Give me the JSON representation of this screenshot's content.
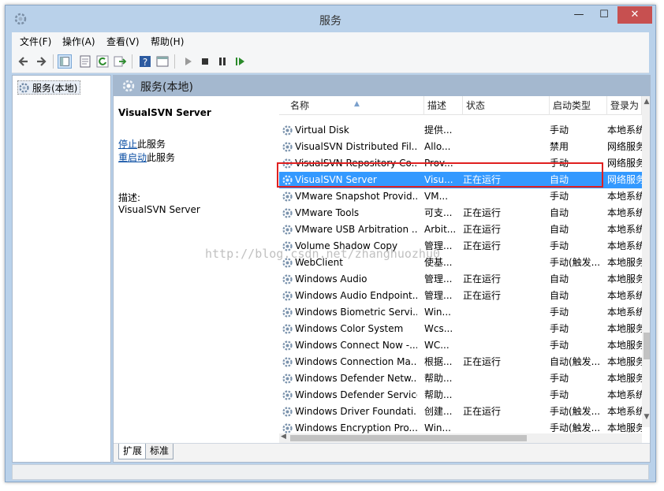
{
  "window": {
    "title": "服务",
    "close_label": "✕",
    "min_label": "—",
    "max_label": "☐"
  },
  "menu": [
    "文件(F)",
    "操作(A)",
    "查看(V)",
    "帮助(H)"
  ],
  "toolbar_icons": [
    "back-icon",
    "forward-icon",
    "show-tree-icon",
    "properties-icon",
    "refresh-icon",
    "export-icon",
    "help-icon",
    "console-icon",
    "start-service-icon",
    "stop-service-icon",
    "pause-service-icon",
    "restart-service-icon"
  ],
  "tree": {
    "root_label": "服务(本地)"
  },
  "main": {
    "header_title": "服务(本地)",
    "selected_service": "VisualSVN Server",
    "stop_link": "停止",
    "stop_suffix": "此服务",
    "restart_link": "重启动",
    "restart_suffix": "此服务",
    "desc_label": "描述:",
    "desc_value": "VisualSVN Server"
  },
  "columns": {
    "name": "名称",
    "desc": "描述",
    "status": "状态",
    "startup": "启动类型",
    "logon": "登录为"
  },
  "services": [
    {
      "name": "Virtual Disk",
      "desc": "提供...",
      "status": "",
      "startup": "手动",
      "logon": "本地系统"
    },
    {
      "name": "VisualSVN Distributed Fil...",
      "desc": "Allo...",
      "status": "",
      "startup": "禁用",
      "logon": "网络服务"
    },
    {
      "name": "VisualSVN Repository Co...",
      "desc": "Prov...",
      "status": "",
      "startup": "手动",
      "logon": "网络服务"
    },
    {
      "name": "VisualSVN Server",
      "desc": "Visu...",
      "status": "正在运行",
      "startup": "自动",
      "logon": "网络服务",
      "selected": true
    },
    {
      "name": "VMware Snapshot Provid...",
      "desc": "VM...",
      "status": "",
      "startup": "手动",
      "logon": "本地系统"
    },
    {
      "name": "VMware Tools",
      "desc": "可支...",
      "status": "正在运行",
      "startup": "自动",
      "logon": "本地系统"
    },
    {
      "name": "VMware USB Arbitration ...",
      "desc": "Arbit...",
      "status": "正在运行",
      "startup": "自动",
      "logon": "本地系统"
    },
    {
      "name": "Volume Shadow Copy",
      "desc": "管理...",
      "status": "正在运行",
      "startup": "手动",
      "logon": "本地系统"
    },
    {
      "name": "WebClient",
      "desc": "使基...",
      "status": "",
      "startup": "手动(触发...",
      "logon": "本地服务"
    },
    {
      "name": "Windows Audio",
      "desc": "管理...",
      "status": "正在运行",
      "startup": "自动",
      "logon": "本地服务"
    },
    {
      "name": "Windows Audio Endpoint...",
      "desc": "管理...",
      "status": "正在运行",
      "startup": "自动",
      "logon": "本地系统"
    },
    {
      "name": "Windows Biometric Servi...",
      "desc": "Win...",
      "status": "",
      "startup": "手动",
      "logon": "本地系统"
    },
    {
      "name": "Windows Color System",
      "desc": "Wcs...",
      "status": "",
      "startup": "手动",
      "logon": "本地服务"
    },
    {
      "name": "Windows Connect Now -...",
      "desc": "WC...",
      "status": "",
      "startup": "手动",
      "logon": "本地服务"
    },
    {
      "name": "Windows Connection Ma...",
      "desc": "根据...",
      "status": "正在运行",
      "startup": "自动(触发...",
      "logon": "本地服务"
    },
    {
      "name": "Windows Defender Netw...",
      "desc": "帮助...",
      "status": "",
      "startup": "手动",
      "logon": "本地服务"
    },
    {
      "name": "Windows Defender Service",
      "desc": "帮助...",
      "status": "",
      "startup": "手动",
      "logon": "本地系统"
    },
    {
      "name": "Windows Driver Foundati...",
      "desc": "创建...",
      "status": "正在运行",
      "startup": "手动(触发...",
      "logon": "本地系统"
    },
    {
      "name": "Windows Encryption Pro...",
      "desc": "Win...",
      "status": "",
      "startup": "手动(触发...",
      "logon": "本地服务"
    }
  ],
  "tabs": [
    "扩展",
    "标准"
  ],
  "watermark": "http://blog.csdn.net/zhanghuozhu0",
  "colors": {
    "selection": "#3399ff",
    "highlight_box": "#e02020",
    "link": "#0b4ea3",
    "close_button": "#c75050"
  }
}
